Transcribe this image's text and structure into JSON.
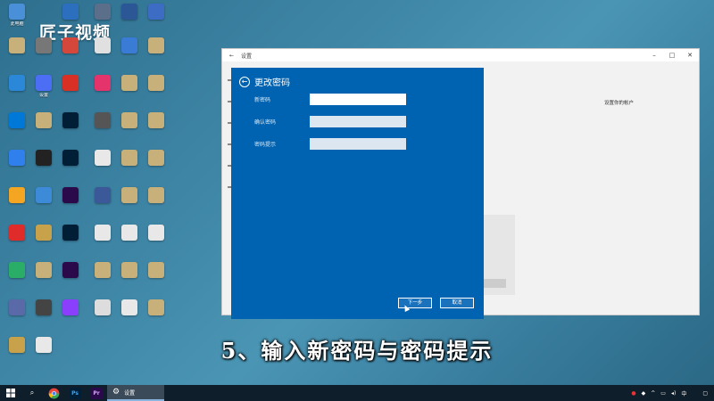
{
  "brand": "匠子视频",
  "desktop_icons": [
    {
      "label": "此电脑",
      "color": "#4a90d9"
    },
    {
      "label": "",
      "color": "#3a7bd5"
    },
    {
      "label": "",
      "color": "#2c6fbf"
    },
    {
      "label": "",
      "color": "#5b6e8a"
    },
    {
      "label": "",
      "color": "#2b5797"
    },
    {
      "label": "",
      "color": "#3d6cc4"
    },
    {
      "label": "",
      "color": "#c8b07a"
    },
    {
      "label": "",
      "color": "#777777"
    },
    {
      "label": "",
      "color": "#d6473b"
    },
    {
      "label": "",
      "color": "#e0e0e0"
    },
    {
      "label": "",
      "color": "#3a7bd5"
    },
    {
      "label": "",
      "color": "#c8b07a"
    },
    {
      "label": "",
      "color": "#2b88d8"
    },
    {
      "label": "设置",
      "color": "#4c6ef5"
    },
    {
      "label": "",
      "color": "#d93025"
    },
    {
      "label": "",
      "color": "#e5336c"
    },
    {
      "label": "",
      "color": "#c8b07a"
    },
    {
      "label": "",
      "color": "#c8b07a"
    },
    {
      "label": "",
      "color": "#0078d7"
    },
    {
      "label": "",
      "color": "#c8b07a"
    },
    {
      "label": "",
      "color": "#001e36"
    },
    {
      "label": "",
      "color": "#555555"
    },
    {
      "label": "",
      "color": "#c8b07a"
    },
    {
      "label": "",
      "color": "#c8b07a"
    },
    {
      "label": "",
      "color": "#2f80ed"
    },
    {
      "label": "",
      "color": "#222222"
    },
    {
      "label": "",
      "color": "#001e36"
    },
    {
      "label": "",
      "color": "#e8e8e8"
    },
    {
      "label": "",
      "color": "#c8b07a"
    },
    {
      "label": "",
      "color": "#c8b07a"
    },
    {
      "label": "",
      "color": "#f4a623"
    },
    {
      "label": "",
      "color": "#3d8bd8"
    },
    {
      "label": "",
      "color": "#2a0a4a"
    },
    {
      "label": "",
      "color": "#3b5998"
    },
    {
      "label": "",
      "color": "#c8b07a"
    },
    {
      "label": "",
      "color": "#c8b07a"
    },
    {
      "label": "",
      "color": "#e02b2b"
    },
    {
      "label": "",
      "color": "#c8a24a"
    },
    {
      "label": "",
      "color": "#001e36"
    },
    {
      "label": "",
      "color": "#e8e8e8"
    },
    {
      "label": "",
      "color": "#e8e8e8"
    },
    {
      "label": "",
      "color": "#e8e8e8"
    },
    {
      "label": "",
      "color": "#2aae67"
    },
    {
      "label": "",
      "color": "#c8b07a"
    },
    {
      "label": "",
      "color": "#2a0a4a"
    },
    {
      "label": "",
      "color": "#c8b07a"
    },
    {
      "label": "",
      "color": "#c8b07a"
    },
    {
      "label": "",
      "color": "#c8b07a"
    },
    {
      "label": "",
      "color": "#5a6aa8"
    },
    {
      "label": "",
      "color": "#444444"
    },
    {
      "label": "",
      "color": "#8a3ffc"
    },
    {
      "label": "",
      "color": "#dddddd"
    },
    {
      "label": "",
      "color": "#e8e8e8"
    },
    {
      "label": "",
      "color": "#c8b07a"
    },
    {
      "label": "",
      "color": "#c8a24a"
    },
    {
      "label": "",
      "color": "#e8e8e8"
    }
  ],
  "settings_window": {
    "title": "设置",
    "right_heading": "设置你的帐户",
    "right_body": "",
    "right_heading2": "",
    "right_link": ""
  },
  "dialog": {
    "title": "更改密码",
    "fields": [
      {
        "label": "新密码",
        "value": "",
        "active": true
      },
      {
        "label": "确认密码",
        "value": "",
        "active": false
      },
      {
        "label": "密码提示",
        "value": "",
        "active": false
      }
    ],
    "next_label": "下一步",
    "cancel_label": "取消"
  },
  "caption": "5、输入新密码与密码提示",
  "taskbar": {
    "start_icon": "windows-logo-icon",
    "active_app": "设置",
    "apps": [
      {
        "name": "search-icon",
        "glyph": "⌕",
        "color": "transparent"
      },
      {
        "name": "chrome-icon",
        "glyph": "",
        "color": "#e8453c"
      },
      {
        "name": "photoshop-icon",
        "glyph": "Ps",
        "color": "#001e36"
      },
      {
        "name": "premiere-icon",
        "glyph": "Pr",
        "color": "#2a0a4a"
      }
    ],
    "clock_time": "",
    "clock_date": ""
  }
}
